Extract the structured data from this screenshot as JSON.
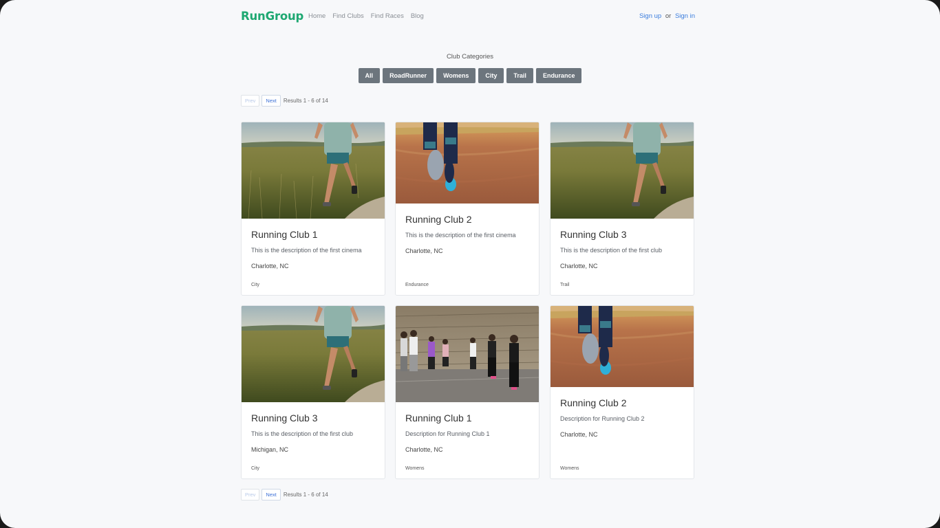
{
  "nav": {
    "brand": "RunGroup",
    "links": [
      "Home",
      "Find Clubs",
      "Find Races",
      "Blog"
    ],
    "sign_up": "Sign up",
    "or": "or",
    "sign_in": "Sign in"
  },
  "categories": {
    "title": "Club Categories",
    "items": [
      "All",
      "RoadRunner",
      "Womens",
      "City",
      "Trail",
      "Endurance"
    ]
  },
  "pagination": {
    "prev": "Prev",
    "next": "Next",
    "info": "Results 1 - 6 of 14"
  },
  "cards": [
    {
      "title": "Running Club 1",
      "description": "This is the description of the first cinema",
      "location": "Charlotte, NC",
      "category": "City",
      "image": "grass-runner"
    },
    {
      "title": "Running Club 2",
      "description": "This is the description of the first cinema",
      "location": "Charlotte, NC",
      "category": "Endurance",
      "image": "dirt-road-legs"
    },
    {
      "title": "Running Club 3",
      "description": "This is the description of the first club",
      "location": "Charlotte, NC",
      "category": "Trail",
      "image": "grass-runner"
    },
    {
      "title": "Running Club 3",
      "description": "This is the description of the first club",
      "location": "Michigan, NC",
      "category": "City",
      "image": "grass-runner"
    },
    {
      "title": "Running Club 1",
      "description": "Description for Running Club 1",
      "location": "Charlotte, NC",
      "category": "Womens",
      "image": "group-runners"
    },
    {
      "title": "Running Club 2",
      "description": "Description for Running Club 2",
      "location": "Charlotte, NC",
      "category": "Womens",
      "image": "dirt-road-legs"
    }
  ],
  "colors": {
    "brand": "#1ea872",
    "link": "#3b7ddd",
    "category_button": "#6c757d",
    "background": "#f7f8fa"
  }
}
